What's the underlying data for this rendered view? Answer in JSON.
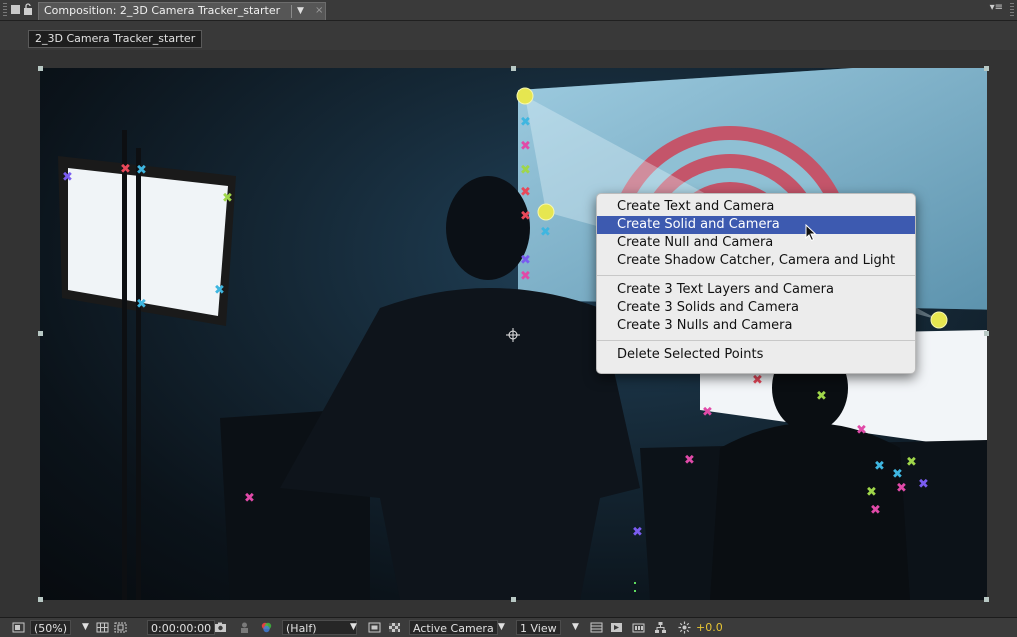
{
  "panel": {
    "tab_title": "Composition: 2_3D Camera Tracker_starter",
    "tab_menu_glyph": "▼",
    "tab_close_glyph": "×",
    "panel_menu_glyph": "▾≡",
    "icons": [
      "composition-panel-icon",
      "lock-icon"
    ]
  },
  "breadcrumb": {
    "label": "2_3D Camera Tracker_starter"
  },
  "context_menu": {
    "groups": [
      [
        {
          "label": "Create Text and Camera"
        },
        {
          "label": "Create Solid and Camera",
          "highlighted": true
        },
        {
          "label": "Create Null and Camera"
        },
        {
          "label": "Create Shadow Catcher, Camera and Light"
        }
      ],
      [
        {
          "label": "Create 3 Text Layers and Camera"
        },
        {
          "label": "Create 3 Solids and Camera"
        },
        {
          "label": "Create 3 Nulls and Camera"
        }
      ],
      [
        {
          "label": "Delete Selected Points"
        }
      ]
    ],
    "highlight_color": "#3d5ab0"
  },
  "toolbar": {
    "magnification": "(50%)",
    "dropdown_glyph": "▼",
    "timecode": "0:00:00:00",
    "resolution": "(Half)",
    "view": "Active Camera",
    "layout": "1 View",
    "exposure": "+0.0",
    "exposure_color": "#e7c534",
    "icons": [
      "always-preview-icon",
      "grid-guides-icon",
      "mask-visibility-icon",
      "snapshot-icon",
      "show-snapshot-icon",
      "color-channels-icon",
      "region-of-interest-icon",
      "transparency-grid-icon",
      "toggle-pixel-aspect-icon",
      "fast-previews-icon",
      "timeline-icon",
      "flowchart-icon",
      "reset-exposure-icon"
    ]
  },
  "track_point_colors": [
    "#e8485a",
    "#3fb6e0",
    "#9fd64a",
    "#e04aa8",
    "#7a5cf0",
    "#e6d230"
  ]
}
